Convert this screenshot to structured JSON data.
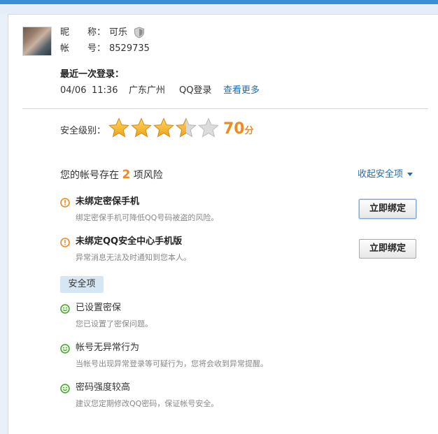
{
  "profile": {
    "nickname_label": "昵　　称：",
    "nickname_value": "可乐",
    "account_label": "帐　　号：",
    "account_value": "8529735"
  },
  "last_login": {
    "heading": "最近一次登录：",
    "date": "04/06",
    "time": "11:36",
    "location": "广东广州",
    "method": "QQ登录",
    "more_link": "查看更多"
  },
  "security_level": {
    "label": "安全级别：",
    "stars_total": 5,
    "stars_value": 3.5,
    "score": "70",
    "score_unit": "分"
  },
  "risks": {
    "prefix": "您的帐号存在",
    "count": "2",
    "suffix": "项风险",
    "collapse_link": "收起安全项",
    "items": [
      {
        "title": "未绑定密保手机",
        "desc": "绑定密保手机可降低QQ号码被盗的风险。",
        "button": "立即绑定"
      },
      {
        "title": "未绑定QQ安全中心手机版",
        "desc": "异常消息无法及时通知到您本人。",
        "button": "立即绑定"
      }
    ]
  },
  "safe": {
    "tag": "安全项",
    "items": [
      {
        "title": "已设置密保",
        "desc": "您已设置了密保问题。"
      },
      {
        "title": "帐号无异常行为",
        "desc": "当帐号出现异常登录等可疑行为，您将会收到异常提醒。"
      },
      {
        "title": "密码强度较高",
        "desc": "建议您定期修改QQ密码，保证帐号安全。"
      }
    ]
  },
  "colors": {
    "accent": "#1d6cb0",
    "score": "#f08a1c",
    "warn": "#f08a1c",
    "ok": "#4aa02c"
  }
}
